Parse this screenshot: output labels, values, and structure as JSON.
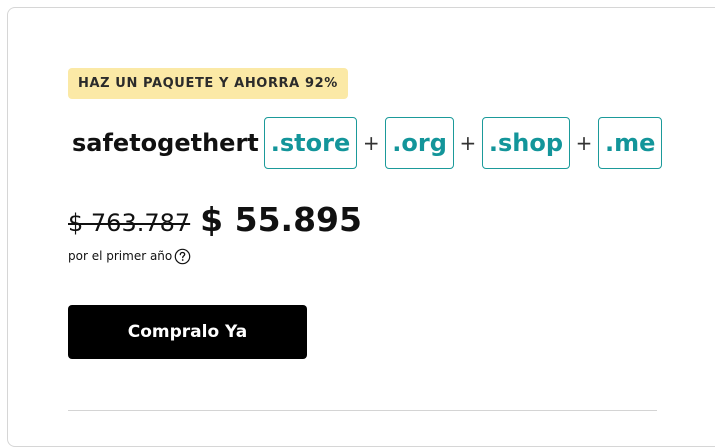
{
  "offer": {
    "badge": "HAZ UN PAQUETE Y AHORRA 92%",
    "domain_name": "safetogethert",
    "tlds": [
      ".store",
      ".org",
      ".shop",
      ".me"
    ],
    "plus": "+",
    "old_price": "$ 763.787",
    "new_price": "$ 55.895",
    "period_label": "por el primer año",
    "help_icon": "question-circle-icon",
    "buy_label": "Compralo Ya"
  },
  "colors": {
    "badge_bg": "#fbe9a6",
    "tld_accent": "#13959a",
    "button_bg": "#000000"
  }
}
